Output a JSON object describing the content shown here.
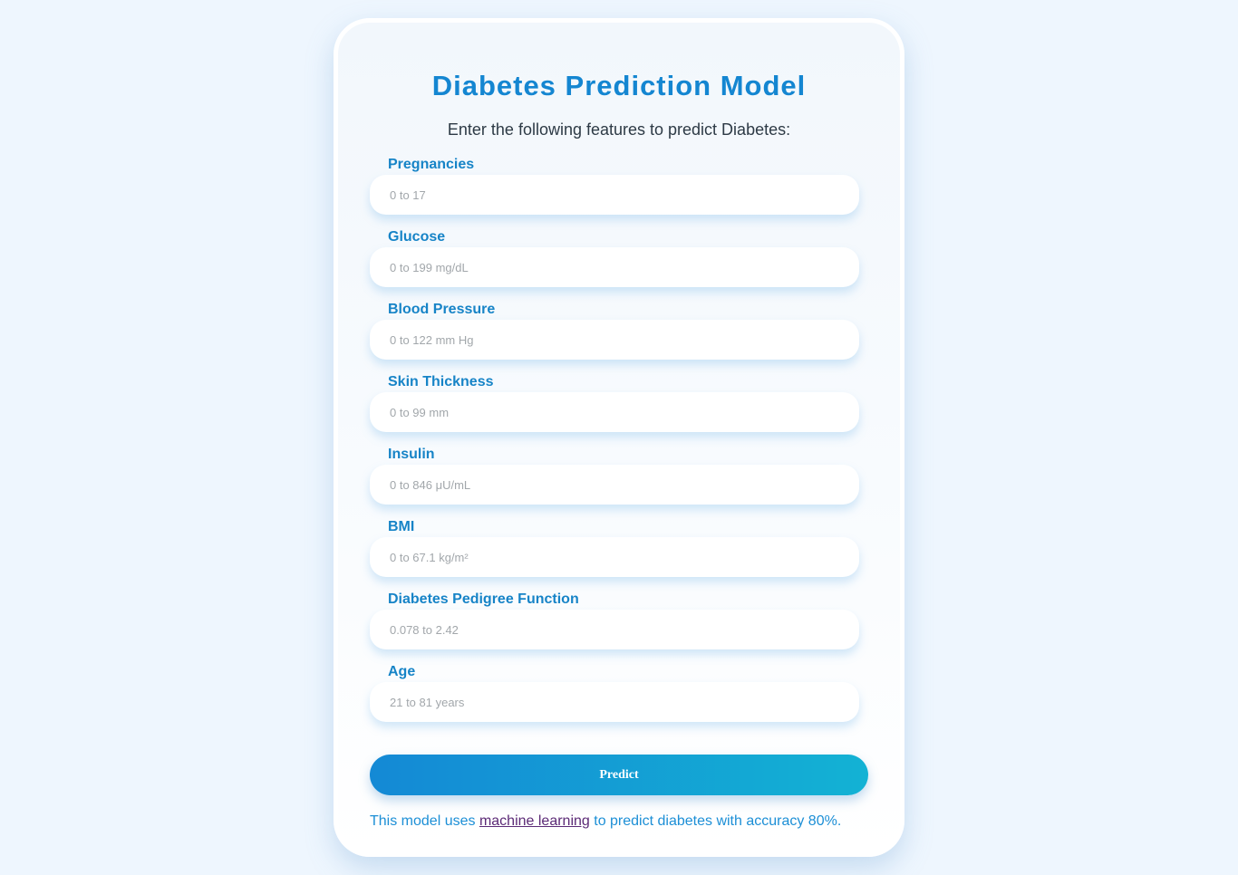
{
  "page": {
    "title": "Diabetes Prediction Model",
    "subtitle": "Enter the following features to predict Diabetes:"
  },
  "fields": [
    {
      "label": "Pregnancies",
      "placeholder": "0 to 17",
      "value": ""
    },
    {
      "label": "Glucose",
      "placeholder": "0 to 199 mg/dL",
      "value": ""
    },
    {
      "label": "Blood Pressure",
      "placeholder": "0 to 122 mm Hg",
      "value": ""
    },
    {
      "label": "Skin Thickness",
      "placeholder": "0 to 99 mm",
      "value": ""
    },
    {
      "label": "Insulin",
      "placeholder": "0 to 846 μU/mL",
      "value": ""
    },
    {
      "label": "BMI",
      "placeholder": "0 to 67.1 kg/m²",
      "value": ""
    },
    {
      "label": "Diabetes Pedigree Function",
      "placeholder": "0.078 to 2.42",
      "value": ""
    },
    {
      "label": "Age",
      "placeholder": "21 to 81 years",
      "value": ""
    }
  ],
  "predict_button": {
    "label": "Predict"
  },
  "footer": {
    "prefix": "This model uses ",
    "link_text": "machine learning",
    "suffix": " to predict diabetes with accuracy 80%."
  },
  "colors": {
    "page_background": "#eef6fe",
    "accent": "#1486d1",
    "button_gradient_start": "#1489d5",
    "button_gradient_end": "#13b2d4",
    "link": "#5b2a76"
  }
}
